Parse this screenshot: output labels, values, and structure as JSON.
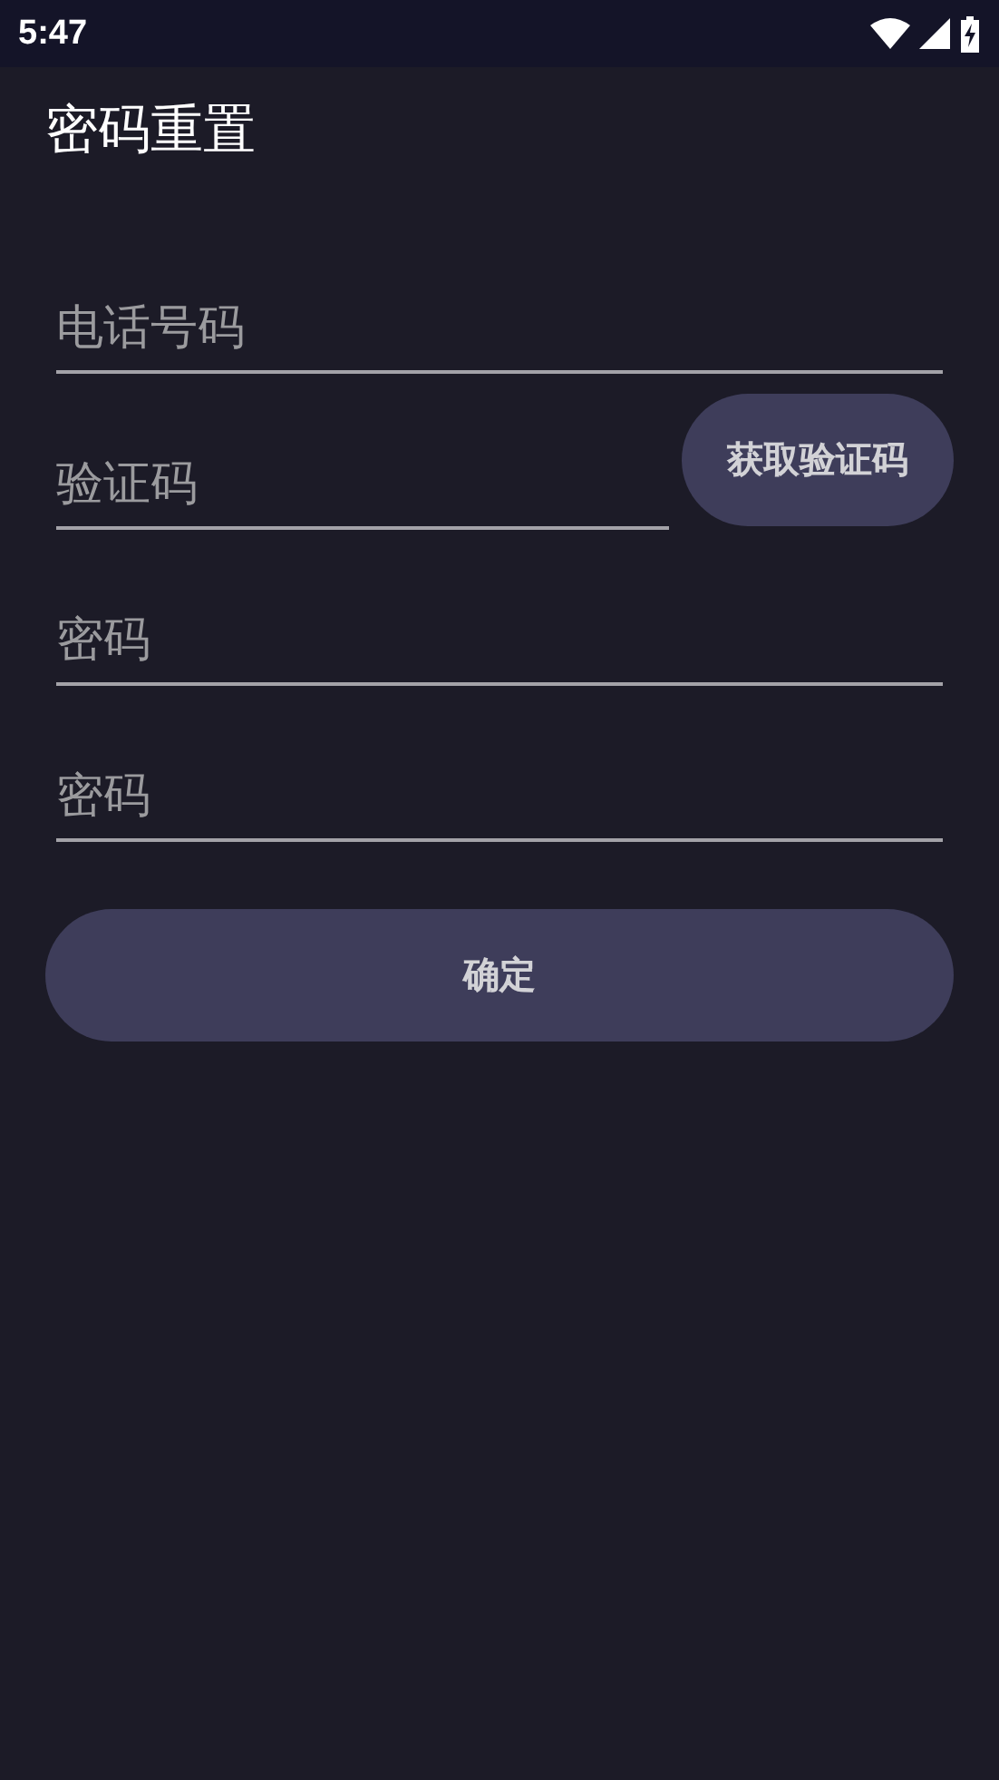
{
  "status_bar": {
    "time": "5:47"
  },
  "app_bar": {
    "title": "密码重置"
  },
  "form": {
    "fields": [
      {
        "kind": "phone",
        "placeholder": "电话号码"
      },
      {
        "kind": "code",
        "placeholder": "验证码",
        "action": "获取验证码"
      },
      {
        "kind": "password",
        "placeholder": "密码"
      },
      {
        "kind": "password",
        "placeholder": "密码"
      }
    ],
    "submit": "确定"
  }
}
